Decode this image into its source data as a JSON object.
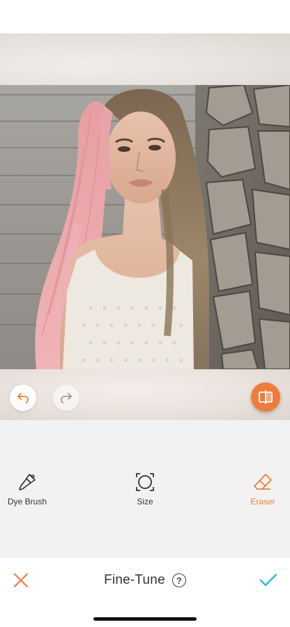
{
  "canvas": {
    "photo_alt": "Woman with long hair, left half dyed pink, leaning against a stone wall"
  },
  "history": {
    "undo_icon": "undo-arrow-icon",
    "redo_icon": "redo-arrow-icon"
  },
  "compare": {
    "icon": "compare-split-icon"
  },
  "tools": [
    {
      "label": "Dye Brush",
      "icon": "brush-icon",
      "active": false
    },
    {
      "label": "Size",
      "icon": "size-circle-icon",
      "active": false
    },
    {
      "label": "Eraser",
      "icon": "eraser-icon",
      "active": true
    }
  ],
  "footer": {
    "title": "Fine-Tune",
    "help_icon_glyph": "?",
    "cancel_icon": "close-x-icon",
    "confirm_icon": "checkmark-icon"
  },
  "colors": {
    "accent": "#ee7d3c",
    "confirm": "#2fb3e6",
    "panel_bg": "#f2f2f2",
    "text": "#333333"
  }
}
